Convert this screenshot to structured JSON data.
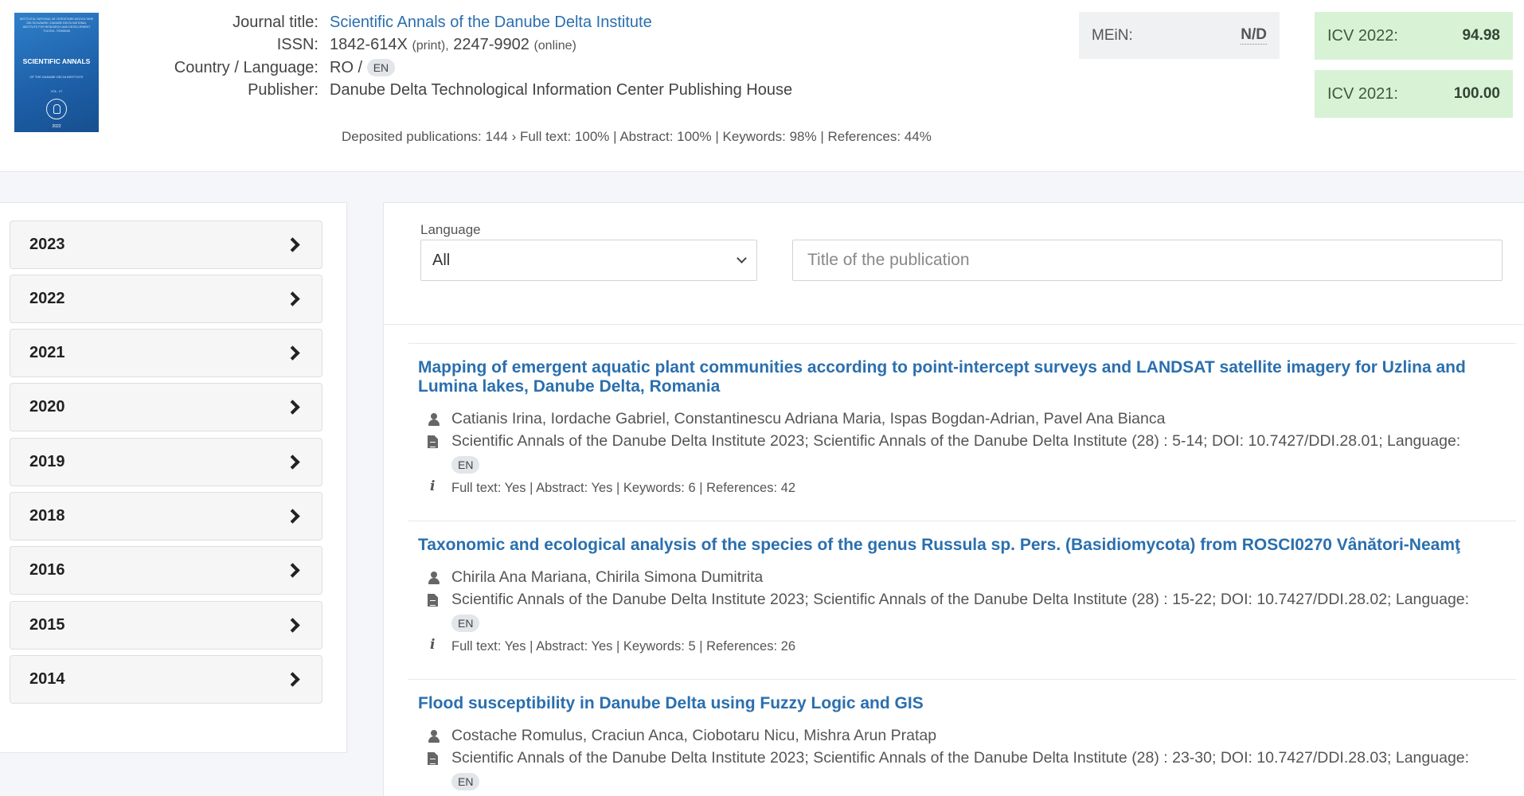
{
  "journal": {
    "cover": {
      "top_text": "INSTITUTUL NATIONAL DE CERCETARE-DEZVOLTARE DELTA DUNARII / DANUBE DELTA NATIONAL INSTITUTE FOR RESEARCH AND DEVELOPMENT TULCEA - ROMANIA",
      "title": "SCIENTIFIC ANNALS",
      "subtitle": "OF THE DANUBE DELTA INSTITUTE",
      "volume": "VOL. 27",
      "year": "2022"
    },
    "labels": {
      "title": "Journal title:",
      "issn": "ISSN:",
      "country": "Country / Language:",
      "publisher": "Publisher:"
    },
    "title": "Scientific Annals of the Danube Delta Institute",
    "issn_print": "1842-614X",
    "issn_print_suffix": "(print),",
    "issn_online": "2247-9902",
    "issn_online_suffix": "(online)",
    "country": "RO /",
    "language": "EN",
    "publisher": "Danube Delta Technological Information Center Publishing House",
    "deposited": "Deposited publications: 144 › Full text: 100% | Abstract: 100% | Keywords: 98% | References: 44%"
  },
  "metrics": {
    "mein_label": "MEiN:",
    "mein_value": "N/D",
    "icv_2022_label": "ICV 2022:",
    "icv_2022_value": "94.98",
    "icv_2021_label": "ICV 2021:",
    "icv_2021_value": "100.00"
  },
  "years": [
    "2023",
    "2022",
    "2021",
    "2020",
    "2019",
    "2018",
    "2016",
    "2015",
    "2014"
  ],
  "filters": {
    "language_label": "Language",
    "language_value": "All",
    "title_placeholder": "Title of the publication"
  },
  "articles": [
    {
      "title": "Mapping of emergent aquatic plant communities according to point-intercept surveys and LANDSAT satellite imagery for Uzlina and Lumina lakes, Danube Delta, Romania",
      "authors": "Catianis Irina, Iordache Gabriel, Constantinescu Adriana Maria, Ispas Bogdan-Adrian, Pavel Ana Bianca",
      "source": "Scientific Annals of the Danube Delta Institute 2023; Scientific Annals of the Danube Delta Institute (28) : 5-14; DOI: 10.7427/DDI.28.01; Language:",
      "language": "EN",
      "info": "Full text: Yes | Abstract: Yes | Keywords: 6 | References: 42"
    },
    {
      "title": "Taxonomic and ecological analysis of the species of the genus Russula sp. Pers. (Basidiomycota) from ROSCI0270 Vânători-Neamţ",
      "authors": "Chirila Ana Mariana, Chirila Simona Dumitrita",
      "source": "Scientific Annals of the Danube Delta Institute 2023; Scientific Annals of the Danube Delta Institute (28) : 15-22; DOI: 10.7427/DDI.28.02; Language:",
      "language": "EN",
      "info": "Full text: Yes | Abstract: Yes | Keywords: 5 | References: 26"
    },
    {
      "title": "Flood susceptibility in Danube Delta using Fuzzy Logic and GIS",
      "authors": "Costache Romulus, Craciun Anca, Ciobotaru Nicu, Mishra Arun Pratap",
      "source": "Scientific Annals of the Danube Delta Institute 2023; Scientific Annals of the Danube Delta Institute (28) : 23-30; DOI: 10.7427/DDI.28.03; Language:",
      "language": "EN"
    }
  ]
}
